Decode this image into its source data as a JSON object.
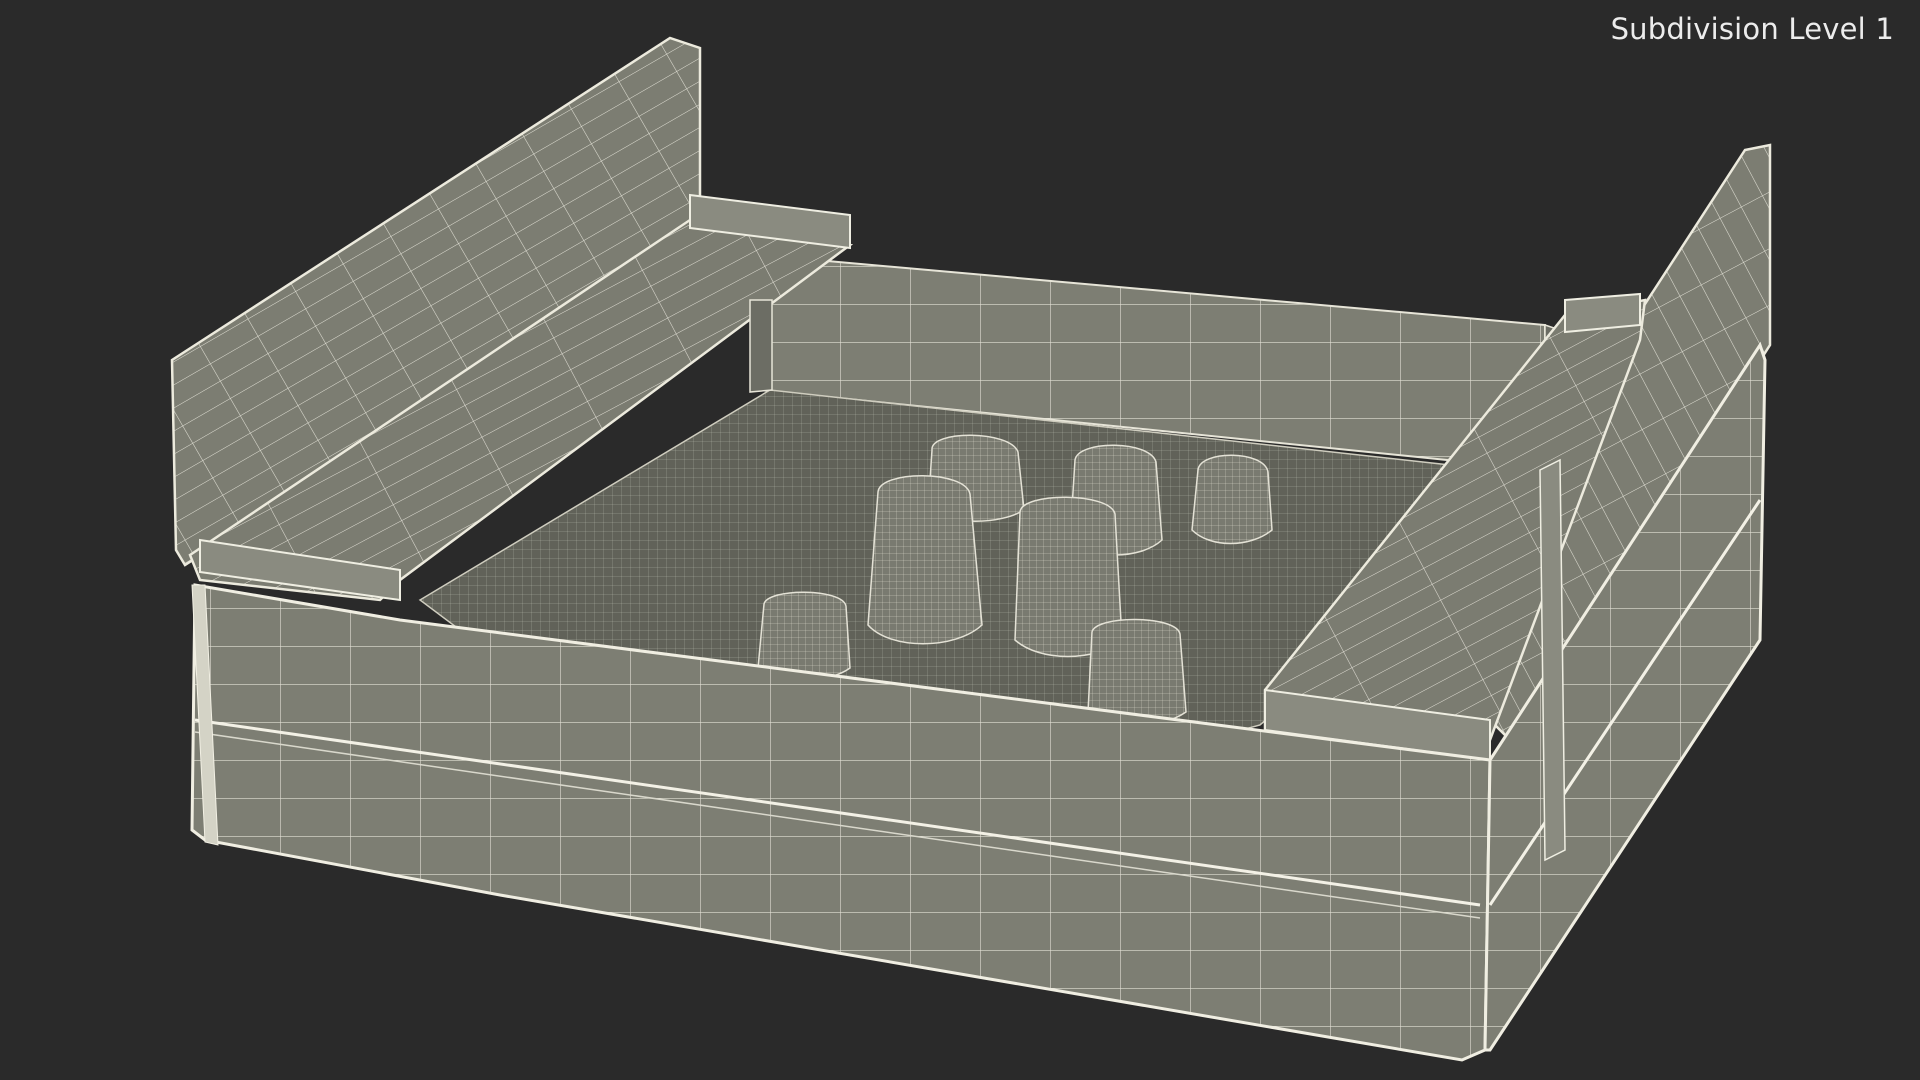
{
  "viewport": {
    "label": "Subdivision Level 1",
    "background": "#2a2a2a"
  },
  "model": {
    "object": "sandbox-with-benches",
    "render_mode": "wireframe",
    "surface_color": "#7c7d72",
    "dark_surface_color": "#5f6058",
    "wire_color": "#f0eee2",
    "edge_color": "#d9d8cc"
  }
}
